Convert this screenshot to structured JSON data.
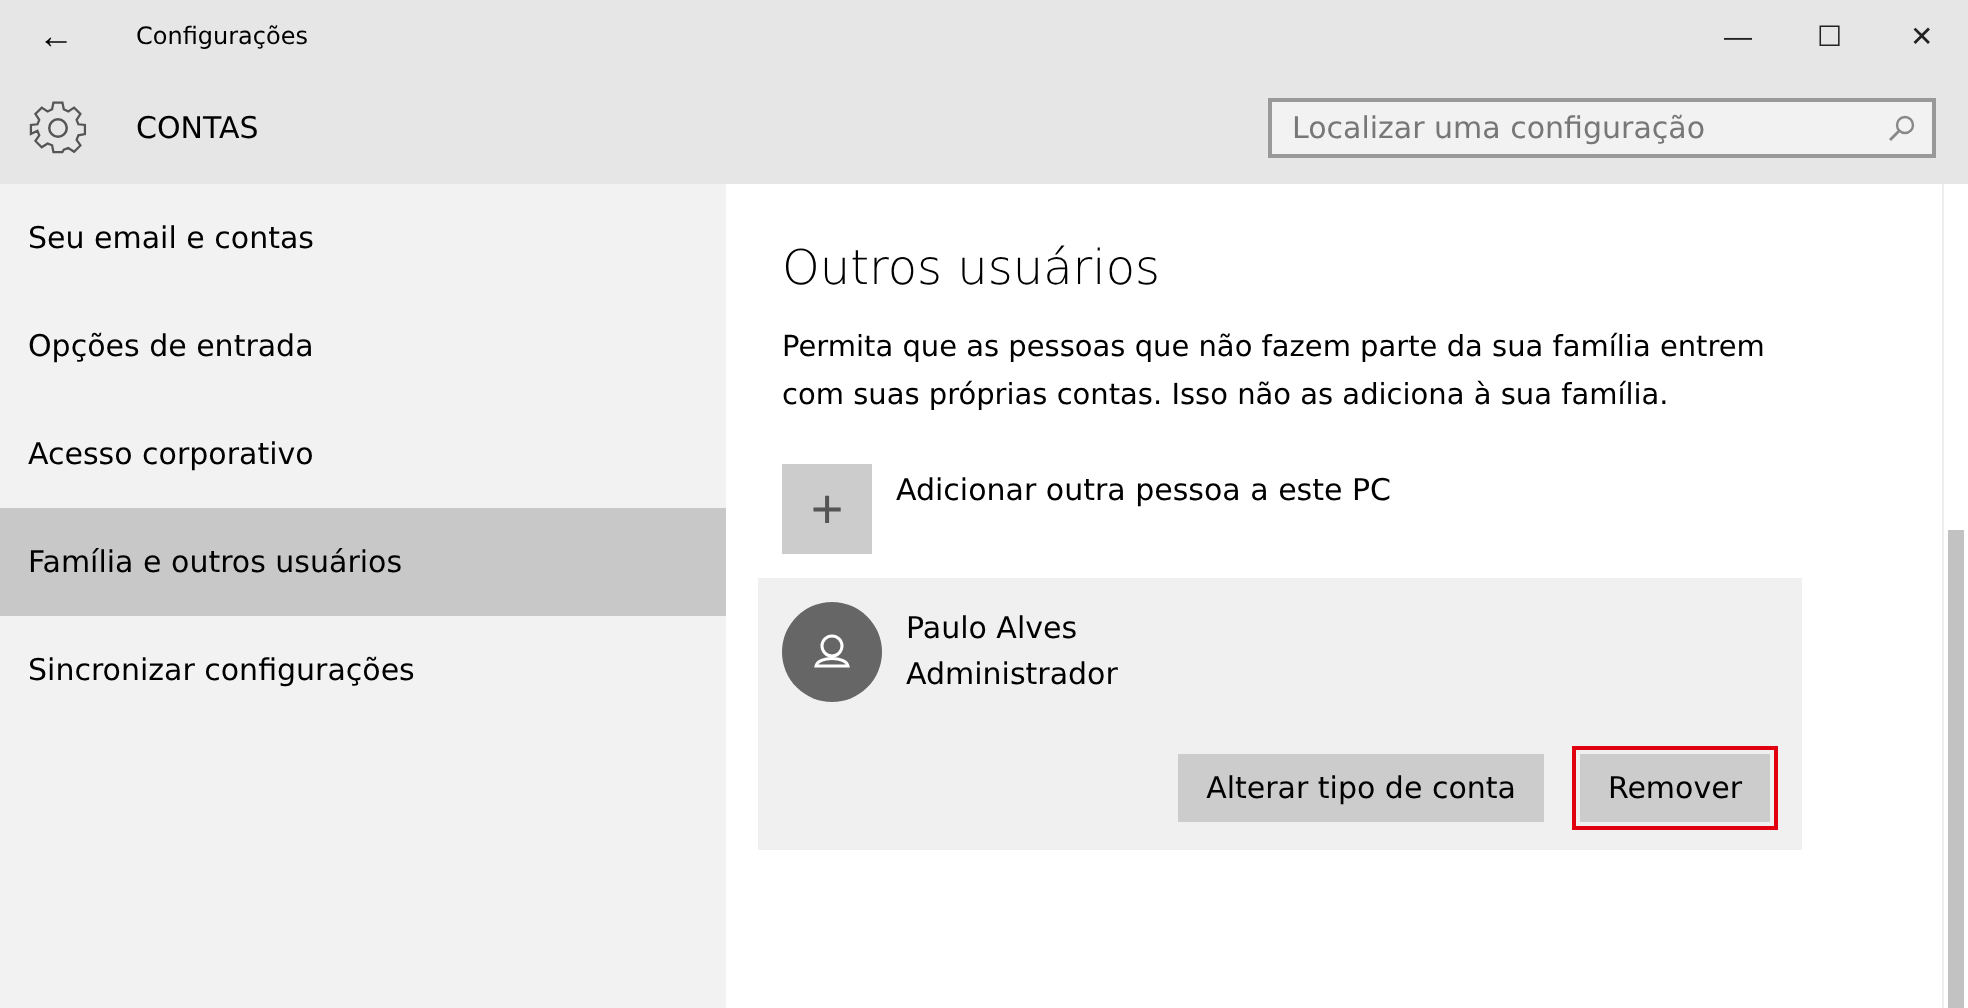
{
  "window": {
    "title": "Configurações",
    "back": "←",
    "controls": [
      "—",
      "☐",
      "✕"
    ]
  },
  "header": {
    "title": "CONTAS",
    "search": {
      "placeholder": "Localizar uma configuração"
    }
  },
  "sidebar": {
    "items": [
      {
        "label": "Seu email e contas",
        "selected": false
      },
      {
        "label": "Opções de entrada",
        "selected": false
      },
      {
        "label": "Acesso corporativo",
        "selected": false
      },
      {
        "label": "Família e outros usuários",
        "selected": true
      },
      {
        "label": "Sincronizar configurações",
        "selected": false
      }
    ]
  },
  "content": {
    "heading": "Outros usuários",
    "description": "Permita que as pessoas que não fazem parte da sua família entrem com suas próprias contas. Isso não as adiciona à sua família.",
    "add": {
      "icon": "+",
      "label": "Adicionar outra pessoa a este PC"
    },
    "users": [
      {
        "name": "Paulo Alves",
        "role": "Administrador",
        "buttons": [
          {
            "label": "Alterar tipo de conta",
            "highlighted": false
          },
          {
            "label": "Remover",
            "highlighted": true
          }
        ]
      }
    ]
  }
}
